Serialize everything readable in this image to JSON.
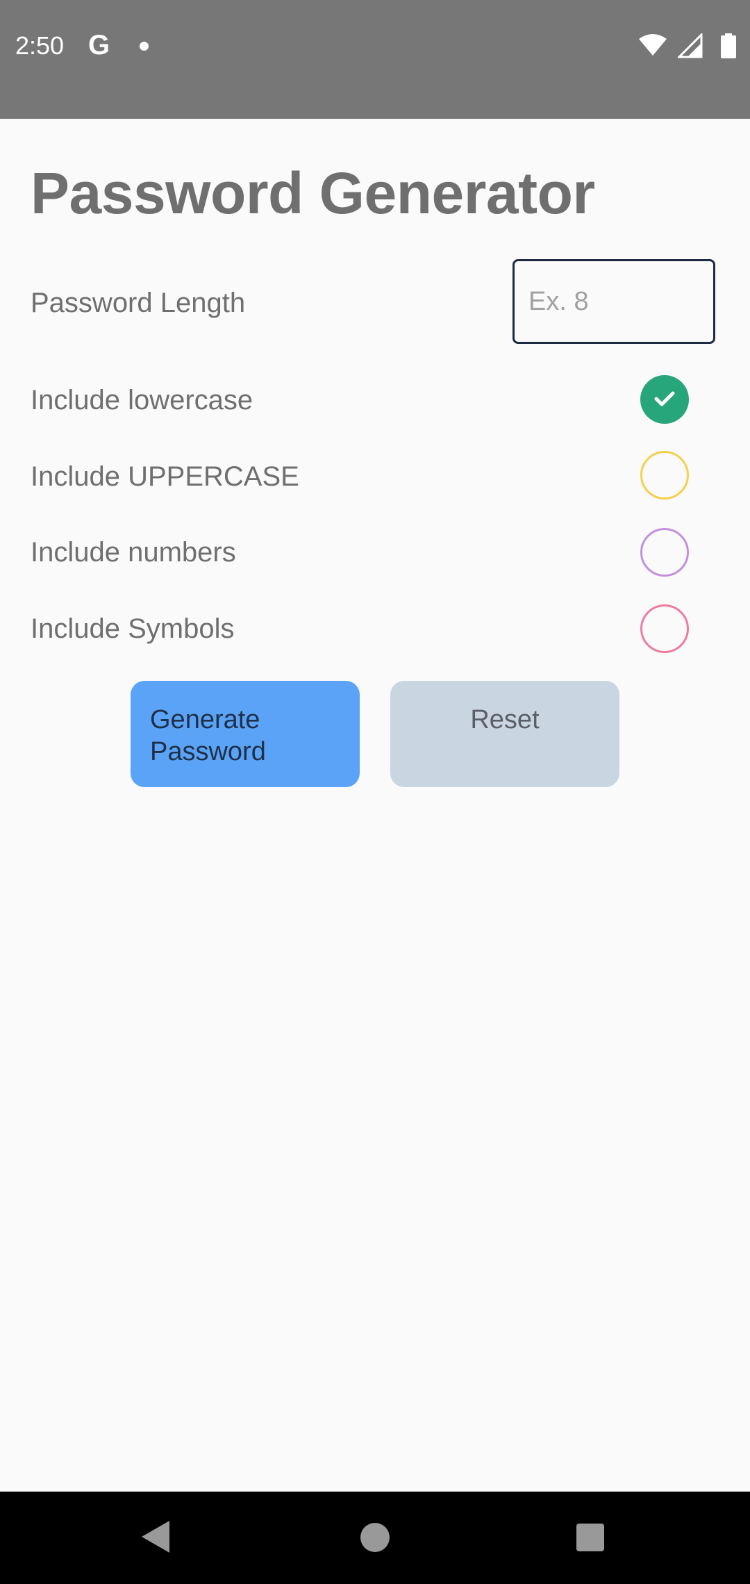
{
  "status_bar": {
    "time": "2:50",
    "google_icon": "G",
    "notification_icon": "dot-icon",
    "icons": [
      "wifi-icon",
      "signal-icon",
      "battery-icon"
    ]
  },
  "app": {
    "title": "Password Generator"
  },
  "form": {
    "length": {
      "label": "Password Length",
      "placeholder": "Ex. 8",
      "value": ""
    },
    "options": [
      {
        "label": "Include lowercase",
        "checked": true,
        "color": "#27a57b"
      },
      {
        "label": "Include UPPERCASE",
        "checked": false,
        "color": "#f5d04d"
      },
      {
        "label": "Include numbers",
        "checked": false,
        "color": "#c38fde"
      },
      {
        "label": "Include Symbols",
        "checked": false,
        "color": "#ee7c9f"
      }
    ]
  },
  "buttons": {
    "generate_label": "Generate Password",
    "reset_label": "Reset",
    "generate_color": "#5ba3f7",
    "reset_color": "#cad5e2"
  },
  "nav_bar": {
    "icons": [
      "back-icon",
      "home-icon",
      "recents-icon"
    ]
  }
}
